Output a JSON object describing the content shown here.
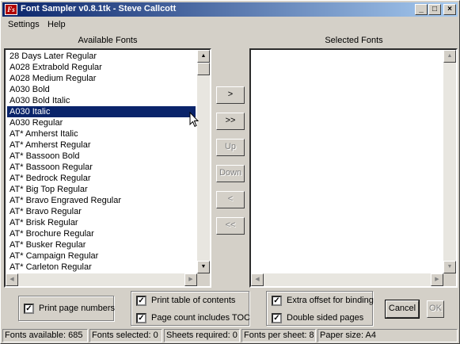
{
  "window": {
    "title": "Font Sampler v0.8.1tk - Steve Callcott",
    "app_icon_glyph": "Fs",
    "minimize": "_",
    "maximize": "□",
    "close": "×"
  },
  "menu": {
    "settings": "Settings",
    "help": "Help"
  },
  "available": {
    "label": "Available Fonts",
    "fonts": [
      "28 Days Later Regular",
      "A028 Extrabold Regular",
      "A028 Medium Regular",
      "A030 Bold",
      "A030 Bold Italic",
      "A030 Italic",
      "A030 Regular",
      "AT* Amherst Italic",
      "AT* Amherst Regular",
      "AT* Bassoon Bold",
      "AT* Bassoon Regular",
      "AT* Bedrock Regular",
      "AT* Big Top Regular",
      "AT* Bravo Engraved Regular",
      "AT* Bravo Regular",
      "AT* Brisk Regular",
      "AT* Brochure Regular",
      "AT* Busker Regular",
      "AT* Campaign Regular",
      "AT* Carleton Regular"
    ],
    "selected_index": 5
  },
  "selected": {
    "label": "Selected Fonts"
  },
  "scroll_arrows": {
    "up": "▲",
    "down": "▼",
    "left": "◀",
    "right": "▶"
  },
  "mid_buttons": {
    "add": ">",
    "add_all": ">>",
    "up": "Up",
    "down": "Down",
    "remove": "<",
    "remove_all": "<<"
  },
  "options": {
    "print_page_numbers": {
      "label": "Print page numbers",
      "checked": true
    },
    "print_toc": {
      "label": "Print table of contents",
      "checked": true
    },
    "page_count_toc": {
      "label": "Page count includes TOC",
      "checked": true
    },
    "extra_offset": {
      "label": "Extra offset for binding",
      "checked": true
    },
    "double_sided": {
      "label": "Double sided pages",
      "checked": true
    },
    "check_mark": "✓"
  },
  "buttons": {
    "cancel": "Cancel",
    "ok": "OK"
  },
  "status": {
    "fonts_available": "Fonts available: 685",
    "fonts_selected": "Fonts selected: 0",
    "sheets_required": "Sheets required: 0",
    "fonts_per_sheet": "Fonts per sheet: 8",
    "paper_size": "Paper size: A4"
  }
}
